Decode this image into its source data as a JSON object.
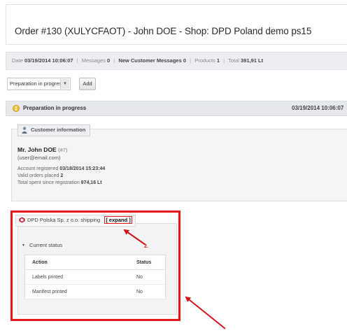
{
  "title": "Order #130 (XULYCFAOT) - John DOE - Shop: DPD Poland demo ps15",
  "info": {
    "date_label": "Date",
    "date_value": "03/19/2014 10:06:07",
    "messages_label": "Messages",
    "messages_value": "0",
    "new_messages_label": "New Customer Messages",
    "new_messages_value": "0",
    "products_label": "Products",
    "products_value": "1",
    "total_label": "Total",
    "total_value": "391,91 Lt"
  },
  "status_form": {
    "selected": "Preparation in progress",
    "add_label": "Add"
  },
  "state": {
    "label": "Preparation in progress",
    "date": "03/19/2014 10:06:07",
    "icon": "hourglass-icon"
  },
  "customer": {
    "legend": "Customer information",
    "name": "Mr. John DOE",
    "id": "(#7)",
    "email": "(user@email.com)",
    "account_registered_label": "Account registered",
    "account_registered_value": "03/18/2014 15:23:44",
    "valid_orders_label": "Valid orders placed",
    "valid_orders_value": "2",
    "total_spent_label": "Total spent since registration",
    "total_spent_value": "974,16 Lt"
  },
  "dpd": {
    "title": "DPD Polska Sp. z o.o. shipping",
    "expand_label": "[ expand ]",
    "current_status_label": "Current status",
    "table": {
      "headers": [
        "Action",
        "Status"
      ],
      "rows": [
        [
          "Labels printed",
          "No"
        ],
        [
          "Manifest printed",
          "No"
        ]
      ]
    }
  },
  "annotations": {
    "arrow2_label": "2."
  },
  "colors": {
    "highlight": "#e2181b",
    "bar_bg": "#eceef2"
  }
}
